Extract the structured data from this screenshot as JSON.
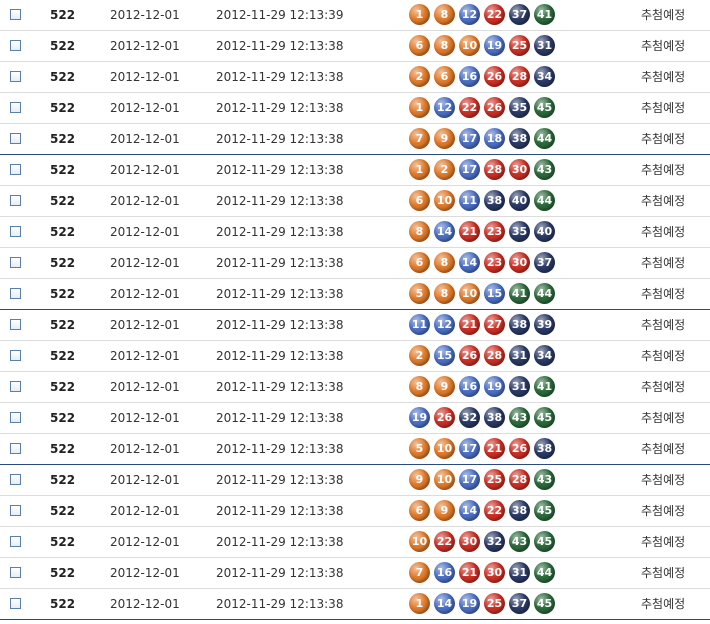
{
  "colors": {
    "range1": "#e07a2a",
    "range2": "#4b6fc4",
    "range3": "#cc2f24",
    "range4": "#2a3a66",
    "range5": "#2b6a3b"
  },
  "rows": [
    {
      "round": "522",
      "date": "2012-12-01",
      "time": "2012-11-29 12:13:39",
      "numbers": [
        1,
        8,
        12,
        22,
        37,
        41
      ],
      "status": "추첨예정"
    },
    {
      "round": "522",
      "date": "2012-12-01",
      "time": "2012-11-29 12:13:38",
      "numbers": [
        6,
        8,
        10,
        19,
        25,
        31
      ],
      "status": "추첨예정"
    },
    {
      "round": "522",
      "date": "2012-12-01",
      "time": "2012-11-29 12:13:38",
      "numbers": [
        2,
        6,
        16,
        26,
        28,
        34
      ],
      "status": "추첨예정"
    },
    {
      "round": "522",
      "date": "2012-12-01",
      "time": "2012-11-29 12:13:38",
      "numbers": [
        1,
        12,
        22,
        26,
        35,
        45
      ],
      "status": "추첨예정"
    },
    {
      "round": "522",
      "date": "2012-12-01",
      "time": "2012-11-29 12:13:38",
      "numbers": [
        7,
        9,
        17,
        18,
        38,
        44
      ],
      "status": "추첨예정"
    },
    {
      "round": "522",
      "date": "2012-12-01",
      "time": "2012-11-29 12:13:38",
      "numbers": [
        1,
        2,
        17,
        28,
        30,
        43
      ],
      "status": "추첨예정"
    },
    {
      "round": "522",
      "date": "2012-12-01",
      "time": "2012-11-29 12:13:38",
      "numbers": [
        6,
        10,
        11,
        38,
        40,
        44
      ],
      "status": "추첨예정"
    },
    {
      "round": "522",
      "date": "2012-12-01",
      "time": "2012-11-29 12:13:38",
      "numbers": [
        8,
        14,
        21,
        23,
        35,
        40
      ],
      "status": "추첨예정"
    },
    {
      "round": "522",
      "date": "2012-12-01",
      "time": "2012-11-29 12:13:38",
      "numbers": [
        6,
        8,
        14,
        23,
        30,
        37
      ],
      "status": "추첨예정"
    },
    {
      "round": "522",
      "date": "2012-12-01",
      "time": "2012-11-29 12:13:38",
      "numbers": [
        5,
        8,
        10,
        15,
        41,
        44
      ],
      "status": "추첨예정"
    },
    {
      "round": "522",
      "date": "2012-12-01",
      "time": "2012-11-29 12:13:38",
      "numbers": [
        11,
        12,
        21,
        27,
        38,
        39
      ],
      "status": "추첨예정"
    },
    {
      "round": "522",
      "date": "2012-12-01",
      "time": "2012-11-29 12:13:38",
      "numbers": [
        2,
        15,
        26,
        28,
        31,
        34
      ],
      "status": "추첨예정"
    },
    {
      "round": "522",
      "date": "2012-12-01",
      "time": "2012-11-29 12:13:38",
      "numbers": [
        8,
        9,
        16,
        19,
        31,
        41
      ],
      "status": "추첨예정"
    },
    {
      "round": "522",
      "date": "2012-12-01",
      "time": "2012-11-29 12:13:38",
      "numbers": [
        19,
        26,
        32,
        38,
        43,
        45
      ],
      "status": "추첨예정"
    },
    {
      "round": "522",
      "date": "2012-12-01",
      "time": "2012-11-29 12:13:38",
      "numbers": [
        5,
        10,
        17,
        21,
        26,
        38
      ],
      "status": "추첨예정"
    },
    {
      "round": "522",
      "date": "2012-12-01",
      "time": "2012-11-29 12:13:38",
      "numbers": [
        9,
        10,
        17,
        25,
        28,
        43
      ],
      "status": "추첨예정"
    },
    {
      "round": "522",
      "date": "2012-12-01",
      "time": "2012-11-29 12:13:38",
      "numbers": [
        6,
        9,
        14,
        22,
        38,
        45
      ],
      "status": "추첨예정"
    },
    {
      "round": "522",
      "date": "2012-12-01",
      "time": "2012-11-29 12:13:38",
      "numbers": [
        10,
        22,
        30,
        32,
        43,
        45
      ],
      "status": "추첨예정"
    },
    {
      "round": "522",
      "date": "2012-12-01",
      "time": "2012-11-29 12:13:38",
      "numbers": [
        7,
        16,
        21,
        30,
        31,
        44
      ],
      "status": "추첨예정"
    },
    {
      "round": "522",
      "date": "2012-12-01",
      "time": "2012-11-29 12:13:38",
      "numbers": [
        1,
        14,
        19,
        25,
        37,
        45
      ],
      "status": "추첨예정"
    }
  ]
}
